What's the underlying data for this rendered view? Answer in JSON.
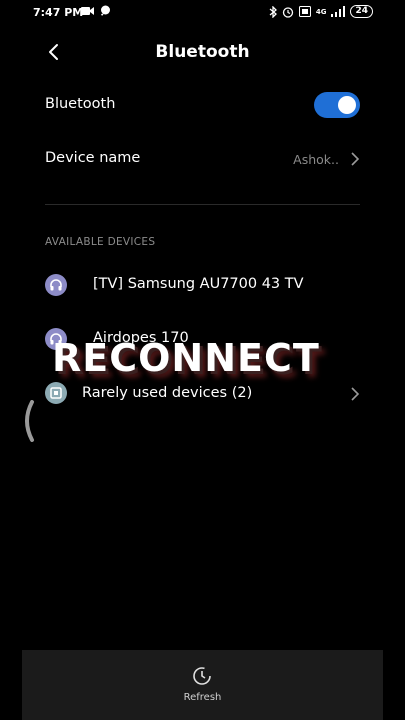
{
  "status_bar": {
    "time": "7:47 PM",
    "signal_label": "4G",
    "battery_level": "24"
  },
  "header": {
    "title": "Bluetooth"
  },
  "settings": {
    "bluetooth_label": "Bluetooth",
    "bluetooth_enabled": true,
    "device_name_label": "Device name",
    "device_name_value": "Ashok.."
  },
  "available_devices": {
    "section_title": "AVAILABLE DEVICES",
    "items": [
      {
        "label": "[TV] Samsung AU7700 43 TV",
        "icon": "headphones-icon"
      },
      {
        "label": "Airdopes 170",
        "icon": "headphones-icon"
      }
    ],
    "rarely_used_label": "Rarely used devices (2)"
  },
  "overlay": {
    "text": "RECONNECT"
  },
  "bottom_bar": {
    "refresh_label": "Refresh"
  },
  "colors": {
    "accent": "#1f6fd6",
    "device_icon_bg": "#8d8cc7",
    "rare_icon_bg": "#8caab3",
    "bottom_bar_bg": "#1b1b1b"
  }
}
